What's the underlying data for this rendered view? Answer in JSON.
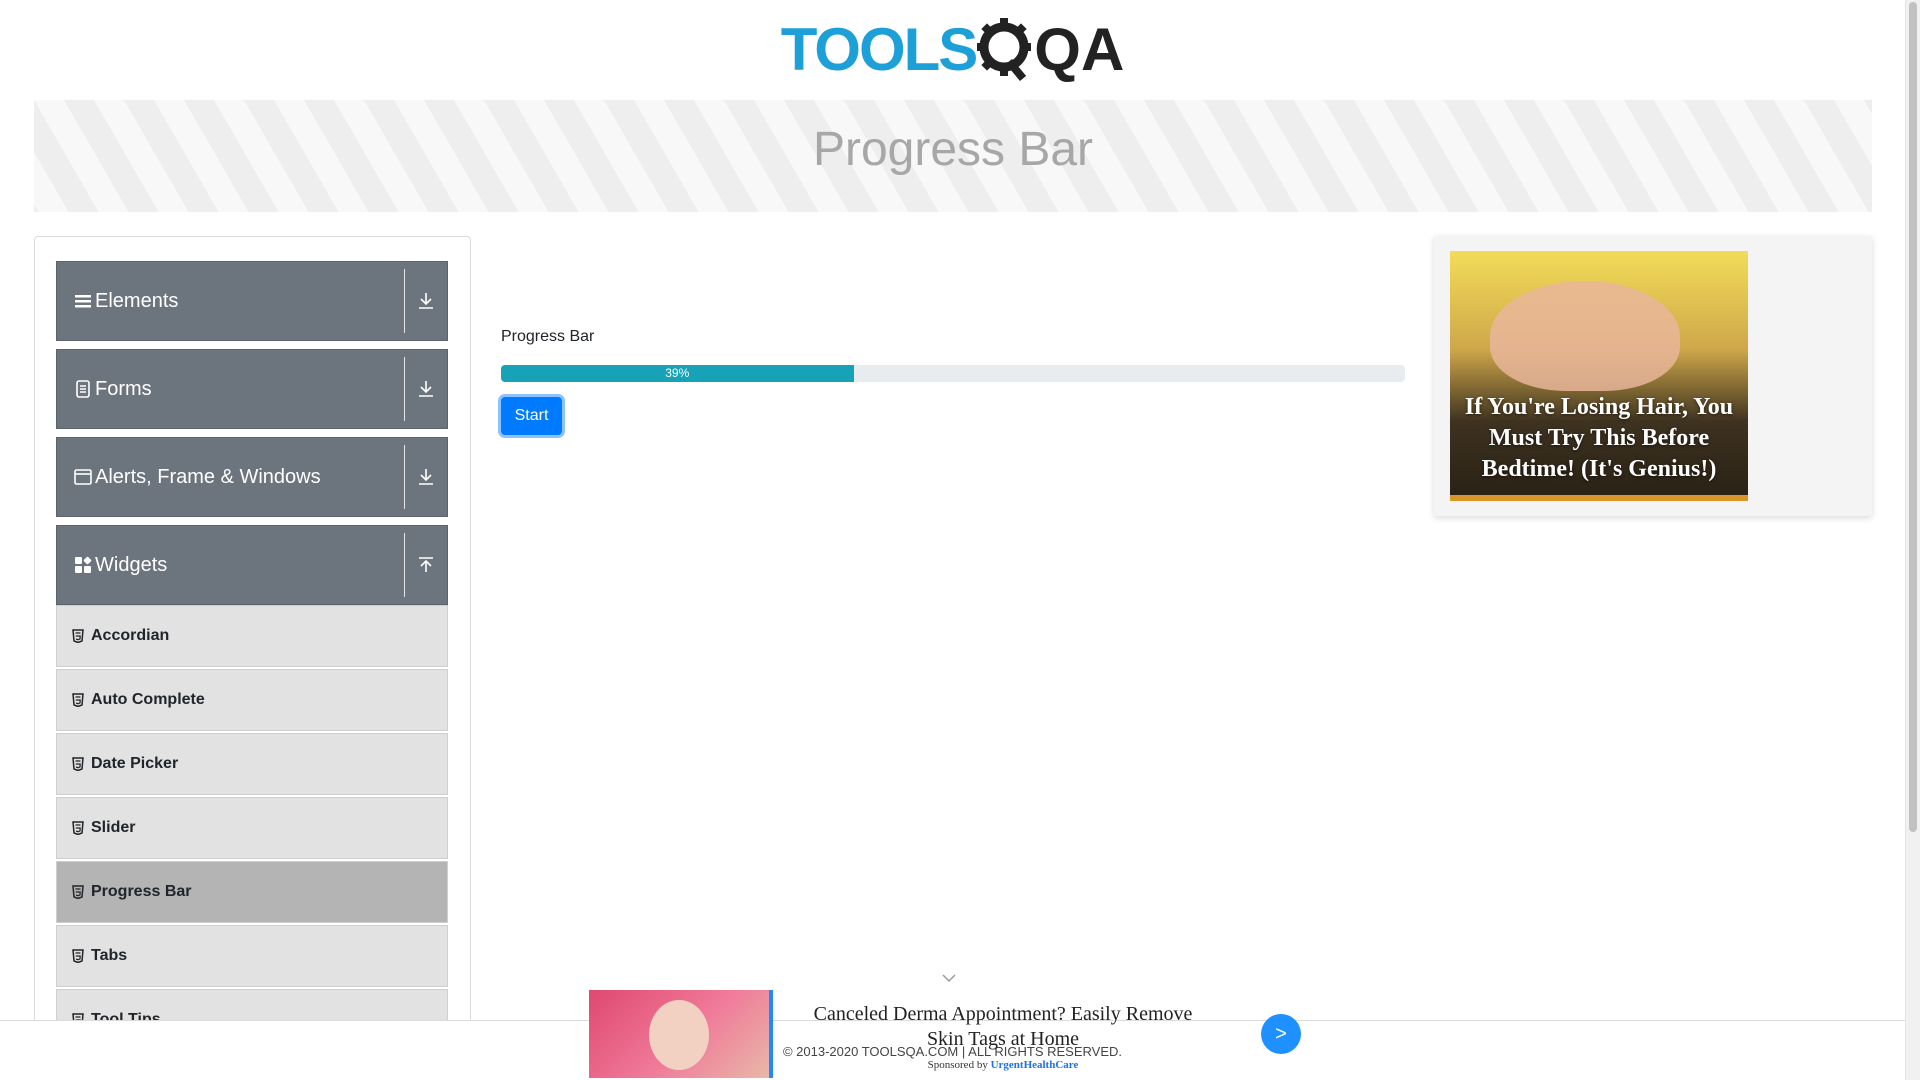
{
  "header": {
    "logo_tools": "TOOLS",
    "logo_qa": "QA"
  },
  "banner": {
    "title": "Progress Bar"
  },
  "sidebar": {
    "groups": [
      {
        "label": "Elements",
        "icon": "menu-icon",
        "arrow": "download-icon"
      },
      {
        "label": "Forms",
        "icon": "document-icon",
        "arrow": "download-icon"
      },
      {
        "label": "Alerts, Frame & Windows",
        "icon": "window-icon",
        "arrow": "download-icon"
      },
      {
        "label": "Widgets",
        "icon": "widgets-icon",
        "arrow": "upload-icon"
      }
    ],
    "items": [
      {
        "label": "Accordian"
      },
      {
        "label": "Auto Complete"
      },
      {
        "label": "Date Picker"
      },
      {
        "label": "Slider"
      },
      {
        "label": "Progress Bar",
        "active": true
      },
      {
        "label": "Tabs"
      },
      {
        "label": "Tool Tips"
      }
    ]
  },
  "content": {
    "heading": "Progress Bar",
    "progress": {
      "value": 39,
      "label": "39%"
    },
    "start_label": "Start"
  },
  "right_ad": {
    "text": "If You're Losing Hair, You Must Try This Before Bedtime! (It's Genius!)"
  },
  "bottom_ad": {
    "title": "Canceled Derma Appointment? Easily Remove Skin Tags at Home",
    "sponsored_by": "Sponsored by",
    "brand": "UrgentHealthCare",
    "go_label": ">"
  },
  "footer": {
    "copyright": "© 2013-2020 TOOLSQA.COM | ALL RIGHTS RESERVED."
  },
  "colors": {
    "accent": "#007bff",
    "progress": "#17a2b8",
    "sidebar_group": "#6c757d"
  }
}
